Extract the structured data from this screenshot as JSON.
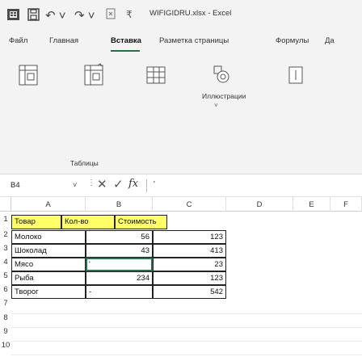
{
  "titlebar": {
    "filename": "WIFIGIDRU.xlsx - Excel",
    "icons": [
      "excel-icon",
      "save-icon",
      "undo-icon",
      "redo-icon",
      "touch-mode-icon",
      "customize-quick-access-icon"
    ]
  },
  "ribbon_tabs": [
    {
      "label": "Файл",
      "active": false
    },
    {
      "label": "Главная",
      "active": false
    },
    {
      "label": "Вставка",
      "active": true
    },
    {
      "label": "Разметка страницы",
      "active": false
    },
    {
      "label": "Формулы",
      "active": false
    },
    {
      "label": "Да",
      "active": false
    }
  ],
  "ribbon": {
    "illustrations_label": "Иллюстрации",
    "tables_label": "Таблицы"
  },
  "formula_bar": {
    "name_box": "B4",
    "content": "'"
  },
  "columns": [
    "A",
    "B",
    "C",
    "D",
    "E",
    "F"
  ],
  "rows": [
    "1",
    "2",
    "3",
    "4",
    "5",
    "6",
    "7",
    "8",
    "9",
    "10"
  ],
  "table": {
    "headers": [
      "Товар",
      "Кол-во",
      "Стоимость"
    ],
    "data": [
      {
        "item": "Молоко",
        "qty": "56",
        "cost": "123"
      },
      {
        "item": "Шоколад",
        "qty": "43",
        "cost": "413"
      },
      {
        "item": "Мясо",
        "qty": "'",
        "cost": "23"
      },
      {
        "item": "Рыба",
        "qty": "234",
        "cost": "123"
      },
      {
        "item": "Творог",
        "qty": "-",
        "cost": "542"
      }
    ]
  },
  "colors": {
    "accent": "#217346",
    "header_fill": "#ffff66"
  }
}
